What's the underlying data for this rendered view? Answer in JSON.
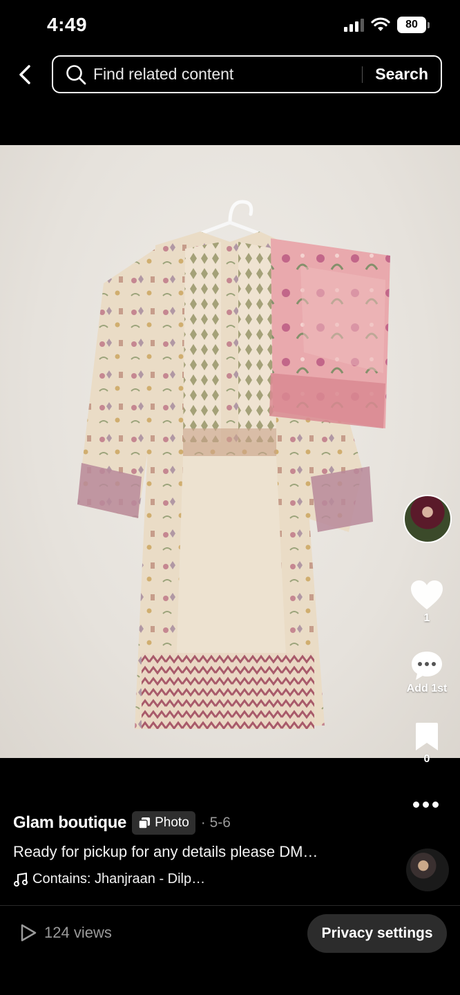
{
  "status_bar": {
    "time": "4:49",
    "battery": "80"
  },
  "search": {
    "placeholder": "Find related content",
    "button_label": "Search"
  },
  "post": {
    "author": "Glam boutique",
    "type_badge": "Photo",
    "date": "· 5-6",
    "caption": "Ready for pickup for any details please DM…",
    "music": "Contains: Jhanjraan - Dilp…"
  },
  "actions": {
    "likes": "1",
    "comments": "Add 1st",
    "saves": "0"
  },
  "footer": {
    "views": "124 views",
    "privacy_label": "Privacy settings"
  },
  "icons": [
    "back-icon",
    "search-icon",
    "heart-icon",
    "comment-icon",
    "bookmark-icon",
    "more-icon",
    "music-note-icon",
    "play-icon",
    "photo-icon"
  ],
  "colors": {
    "background": "#000000",
    "muted_text": "#9a9a9a",
    "badge_bg": "#2e2e2e",
    "button_bg": "#2c2c2c"
  }
}
